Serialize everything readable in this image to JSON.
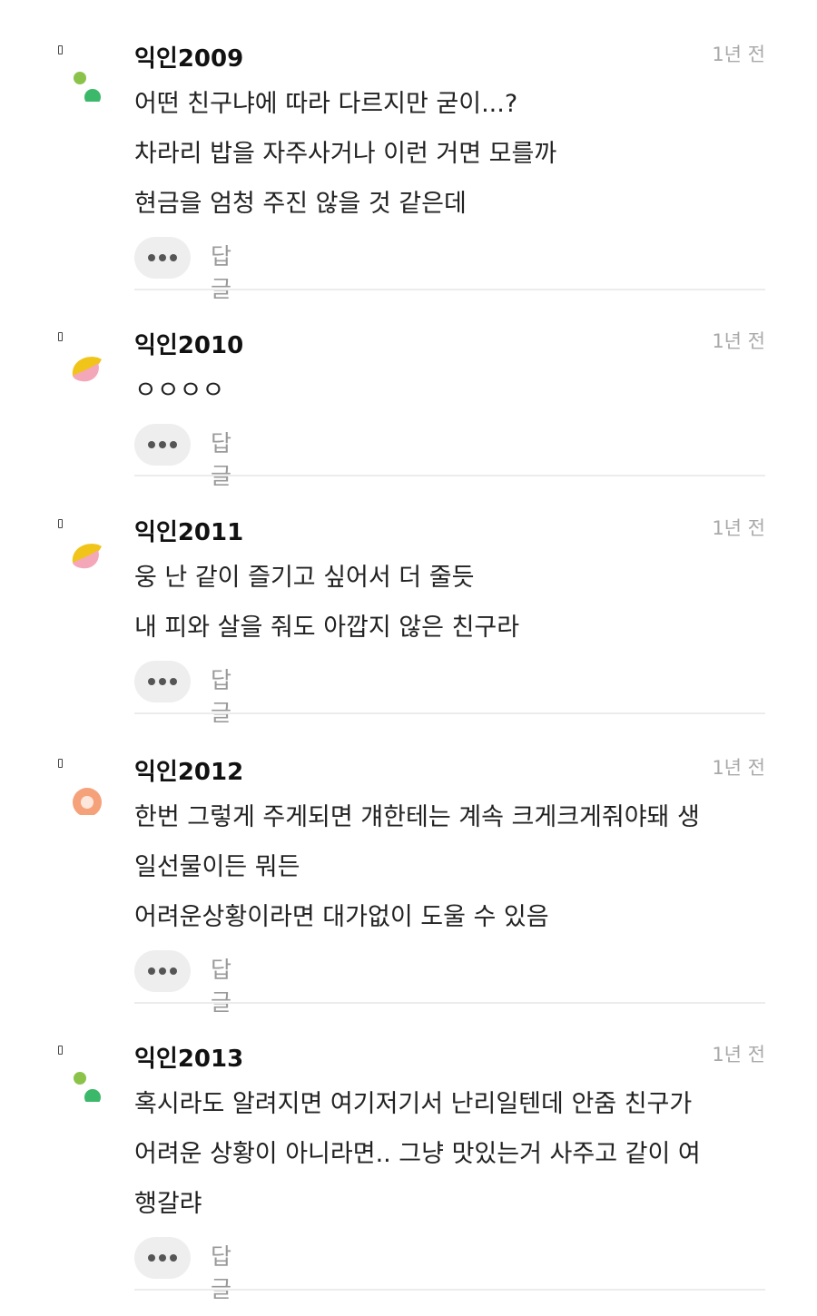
{
  "colors": {
    "background": "#ffffff",
    "author_text": "#111111",
    "body_text": "#222222",
    "time_text": "#a9a9a9",
    "reply_text": "#9a9a9a",
    "button_bg": "#eeeeee",
    "divider": "#ececec"
  },
  "comments": [
    {
      "author": "익인2009",
      "time": "1년 전",
      "avatar": "dots-avatar-icon",
      "lines": [
        "어떤 친구냐에 따라 다르지만 굳이...?",
        "차라리 밥을 자주사거나 이런 거면 모를까",
        "현금을 엄청 주진 않을 것 같은데"
      ],
      "more_label": "•••",
      "reply_label": "답글"
    },
    {
      "author": "익인2010",
      "time": "1년 전",
      "avatar": "yellow-pink-avatar-icon",
      "lines": [
        "ㅇㅇㅇㅇ"
      ],
      "more_label": "•••",
      "reply_label": "답글"
    },
    {
      "author": "익인2011",
      "time": "1년 전",
      "avatar": "yellow-pink-avatar-icon",
      "lines": [
        "웅 난 같이 즐기고 싶어서 더 줄듯",
        "내 피와 살을 줘도 아깝지 않은 친구라"
      ],
      "more_label": "•••",
      "reply_label": "답글"
    },
    {
      "author": "익인2012",
      "time": "1년 전",
      "avatar": "orange-ring-avatar-icon",
      "lines": [
        "한번 그렇게 주게되면 걔한테는 계속 크게크게줘야돼 생",
        "일선물이든 뭐든",
        "어려운상황이라면 대가없이 도울 수 있음"
      ],
      "more_label": "•••",
      "reply_label": "답글"
    },
    {
      "author": "익인2013",
      "time": "1년 전",
      "avatar": "dots-avatar-icon",
      "lines": [
        "혹시라도 알려지면 여기저기서 난리일텐데 안줌 친구가",
        "어려운 상황이 아니라면.. 그냥 맛있는거 사주고 같이 여",
        "행갈랴"
      ],
      "more_label": "•••",
      "reply_label": "답글"
    }
  ]
}
